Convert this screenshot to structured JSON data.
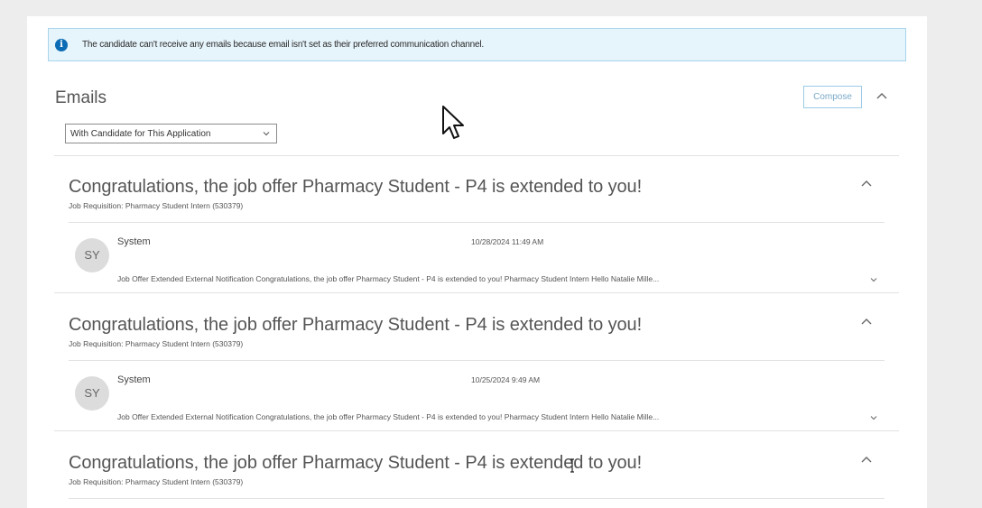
{
  "banner": {
    "icon": "info-icon",
    "text": "The candidate can't receive any emails because email isn't set as their preferred communication channel."
  },
  "emails_section": {
    "title": "Emails",
    "compose_label": "Compose",
    "filter_selected": "With Candidate for This Application"
  },
  "emails": [
    {
      "subject": "Congratulations, the job offer Pharmacy Student - P4 is extended to you!",
      "requisition": "Job Requisition: Pharmacy Student Intern (530379)",
      "avatar_initials": "SY",
      "sender": "System",
      "timestamp": "10/28/2024 11:49 AM",
      "preview": "Job Offer Extended External Notification Congratulations, the job offer Pharmacy Student - P4 is extended to you! Pharmacy Student Intern Hello Natalie Mille..."
    },
    {
      "subject": "Congratulations, the job offer Pharmacy Student - P4 is extended to you!",
      "requisition": "Job Requisition: Pharmacy Student Intern (530379)",
      "avatar_initials": "SY",
      "sender": "System",
      "timestamp": "10/25/2024 9:49 AM",
      "preview": "Job Offer Extended External Notification Congratulations, the job offer Pharmacy Student - P4 is extended to you! Pharmacy Student Intern Hello Natalie Mille..."
    },
    {
      "subject": "Congratulations, the job offer Pharmacy Student - P4 is extended to you!",
      "requisition": "Job Requisition: Pharmacy Student Intern (530379)"
    }
  ],
  "colors": {
    "banner_background": "#e6f4fb",
    "info_icon": "#0b6cb5",
    "compose_border": "#9ccbe6"
  }
}
